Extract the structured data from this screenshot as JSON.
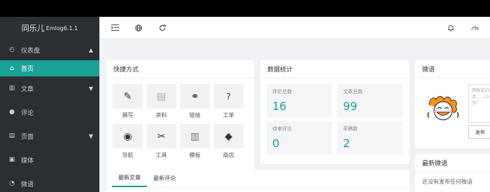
{
  "sidebar": {
    "brand": "同乐儿",
    "version": "Emlog6.1.1",
    "items": [
      {
        "label": "仪表盘",
        "icon": "gauge-icon",
        "arrow": "▲"
      },
      {
        "label": "首页",
        "icon": "home-icon"
      },
      {
        "label": "文章",
        "icon": "book-icon",
        "arrow": "▼"
      },
      {
        "label": "评论",
        "icon": "comment-icon"
      },
      {
        "label": "页面",
        "icon": "page-icon",
        "arrow": "▼"
      },
      {
        "label": "媒体",
        "icon": "image-icon"
      },
      {
        "label": "微语",
        "icon": "chat-icon"
      }
    ]
  },
  "header": {
    "icons": [
      "menu-indent-icon",
      "globe-icon",
      "refresh-icon"
    ],
    "right_icons": [
      "bell-icon",
      "theme-icon"
    ]
  },
  "quick": {
    "title": "快捷方式",
    "items": [
      {
        "label": "撰写",
        "icon": "pencil-icon",
        "glyph": "✎"
      },
      {
        "label": "资料",
        "icon": "clipboard-icon",
        "glyph": "▤"
      },
      {
        "label": "链接",
        "icon": "link-icon",
        "glyph": "⚭"
      },
      {
        "label": "工单",
        "icon": "question-icon",
        "glyph": "?"
      },
      {
        "label": "导航",
        "icon": "compass-icon",
        "glyph": "◉"
      },
      {
        "label": "工具",
        "icon": "tools-icon",
        "glyph": "✂"
      },
      {
        "label": "模板",
        "icon": "template-icon",
        "glyph": "▥"
      },
      {
        "label": "商店",
        "icon": "store-icon",
        "glyph": "◆"
      }
    ]
  },
  "stats": {
    "title": "数据统计",
    "items": [
      {
        "label": "评论总数",
        "value": "16"
      },
      {
        "label": "文章总数",
        "value": "99"
      },
      {
        "label": "待审评论",
        "value": "0"
      },
      {
        "label": "草稿数",
        "value": "2"
      }
    ]
  },
  "twitter": {
    "title": "微语",
    "placeholder": "用微语记录生活……(140字)",
    "button": "发布"
  },
  "new_twitter": {
    "title": "最新微语",
    "empty": "还没有发布任何微语"
  },
  "articles": {
    "tabs": [
      "最新文章",
      "最新评论"
    ]
  },
  "colors": {
    "accent": "#1aa394",
    "sidebar": "#2b2f33"
  }
}
